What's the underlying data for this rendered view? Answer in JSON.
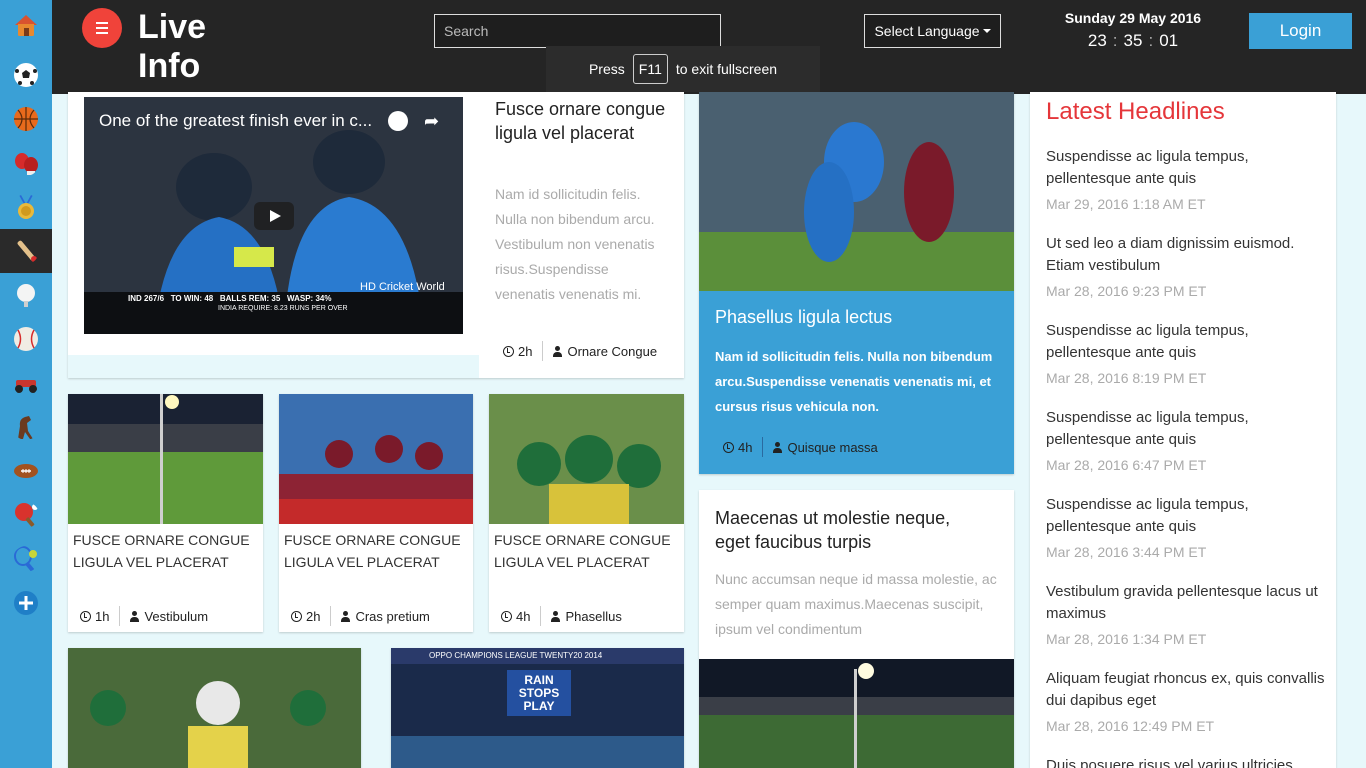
{
  "app": {
    "logo_line1": "Live",
    "logo_line2": "Info"
  },
  "sidebar": {
    "items": [
      {
        "name": "home-icon",
        "color": "#e8892f"
      },
      {
        "name": "soccer-icon",
        "color": "#ffffff"
      },
      {
        "name": "basketball-icon",
        "color": "#e86a1c"
      },
      {
        "name": "boxing-icon",
        "color": "#d62b2b"
      },
      {
        "name": "medal-icon",
        "color": "#e9b93a"
      },
      {
        "name": "cricket-icon",
        "color": "#e3c08a",
        "active": true
      },
      {
        "name": "golf-icon",
        "color": "#f4f4f4"
      },
      {
        "name": "baseball-icon",
        "color": "#f0ece4"
      },
      {
        "name": "motorsport-icon",
        "color": "#c9362f"
      },
      {
        "name": "horse-racing-icon",
        "color": "#6b3a1f"
      },
      {
        "name": "american-football-icon",
        "color": "#a2521f"
      },
      {
        "name": "table-tennis-icon",
        "color": "#d9332d"
      },
      {
        "name": "tennis-icon",
        "color": "#c8d63a"
      },
      {
        "name": "more-sports-icon",
        "color": "#1f7fc7"
      }
    ]
  },
  "header": {
    "search_placeholder": "Search",
    "language_label": "Select Language",
    "date": "Sunday 29 May 2016",
    "time_h": "23",
    "time_m": "35",
    "time_s": "01",
    "login_label": "Login"
  },
  "fullscreen_notice": {
    "press": "Press",
    "key": "F11",
    "rest": "to exit fullscreen"
  },
  "featured": {
    "video_title": "One of the greatest finish ever in c...",
    "video_watermark": "HD Cricket World",
    "scorebar": "IND 267/6   TO WIN: 48   BALLS REM: 35   WASP: 34%",
    "scorebar_sub": "INDIA REQUIRE: 8.23 RUNS PER OVER",
    "title": "Fusce ornare congue ligula vel placerat",
    "desc": "Nam id sollicitudin felis. Nulla non bibendum arcu. Vestibulum non venenatis risus.Suspendisse venenatis venenatis mi.",
    "time": "2h",
    "author": "Ornare Congue"
  },
  "small_cards": [
    {
      "caption": "Fusce ornare congue ligula vel placerat",
      "time": "1h",
      "author": "Vestibulum"
    },
    {
      "caption": "Fusce ornare congue ligula vel placerat",
      "time": "2h",
      "author": "Cras pretium"
    },
    {
      "caption": "Fusce ornare congue ligula vel placerat",
      "time": "4h",
      "author": "Phasellus"
    }
  ],
  "bottom_images": {
    "rain_sign": "RAIN STOPS PLAY",
    "banner": "OPPO CHAMPIONS LEAGUE TWENTY20 2014"
  },
  "blue_card": {
    "title": "Phasellus ligula lectus",
    "desc": "Nam id sollicitudin felis. Nulla non bibendum arcu.Suspendisse venenatis venenatis mi, et cursus risus vehicula non.",
    "time": "4h",
    "author": "Quisque massa"
  },
  "text_card": {
    "title": "Maecenas ut molestie neque, eget faucibus turpis",
    "desc": "Nunc accumsan neque id massa molestie, ac semper quam maximus.Maecenas suscipit, ipsum vel condimentum"
  },
  "headlines": {
    "title": "Latest Headlines",
    "items": [
      {
        "text": "Suspendisse ac ligula tempus, pellentesque ante quis",
        "time": "Mar 29, 2016 1:18 AM ET"
      },
      {
        "text": "Ut sed leo a diam dignissim euismod. Etiam vestibulum",
        "time": "Mar 28, 2016 9:23 PM ET"
      },
      {
        "text": "Suspendisse ac ligula tempus, pellentesque ante quis",
        "time": "Mar 28, 2016 8:19 PM ET"
      },
      {
        "text": "Suspendisse ac ligula tempus, pellentesque ante quis",
        "time": "Mar 28, 2016 6:47 PM ET"
      },
      {
        "text": "Suspendisse ac ligula tempus, pellentesque ante quis",
        "time": "Mar 28, 2016 3:44 PM ET"
      },
      {
        "text": "Vestibulum gravida pellentesque lacus ut maximus",
        "time": "Mar 28, 2016 1:34 PM ET"
      },
      {
        "text": "Aliquam feugiat rhoncus ex, quis convallis dui dapibus eget",
        "time": "Mar 28, 2016 12:49 PM ET"
      },
      {
        "text": "Duis posuere risus vel varius ultricies",
        "time": ""
      }
    ]
  },
  "colors": {
    "accent": "#3aa0d6",
    "header_bg": "#252525",
    "headline_red": "#e5363a",
    "menu_red": "#f0433a"
  }
}
